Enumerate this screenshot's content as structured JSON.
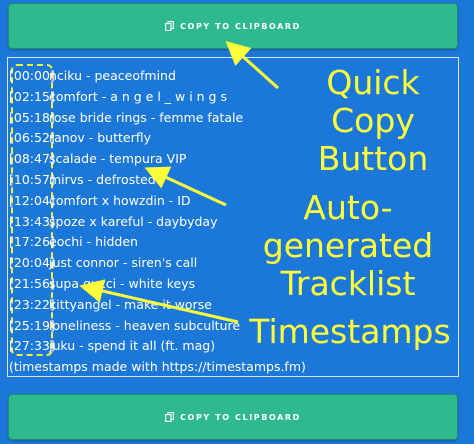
{
  "buttons": {
    "top_label": "COPY TO CLIPBOARD",
    "bottom_label": "COPY TO CLIPBOARD",
    "icon": "copy-icon"
  },
  "tracks": [
    {
      "time": "[00:00]",
      "title": "nciku - peaceofmind"
    },
    {
      "time": "[02:15]",
      "title": "comfort - a n g e l _ w i n g s"
    },
    {
      "time": "[05:18]",
      "title": "rose bride rings - femme fatale"
    },
    {
      "time": "[06:52]",
      "title": "ranov - butterfly"
    },
    {
      "time": "[08:47]",
      "title": "scalade - tempura VIP"
    },
    {
      "time": "[10:57]",
      "title": "mirvs - defrosted"
    },
    {
      "time": "[12:04]",
      "title": "comfort x howzdin - ID"
    },
    {
      "time": "[13:43]",
      "title": "spoze x kareful - daybyday"
    },
    {
      "time": "[17:26]",
      "title": "eochi - hidden"
    },
    {
      "time": "[20:04]",
      "title": "just connor - siren's call"
    },
    {
      "time": "[21:56]",
      "title": "supa gucci - white keys"
    },
    {
      "time": "[23:22]",
      "title": "kittyangel - make it worse"
    },
    {
      "time": "[25:19]",
      "title": "loneliness - heaven subculture"
    },
    {
      "time": "[27:33]",
      "title": "juku - spend it all (ft. mag)"
    }
  ],
  "footer_note": "(timestamps made with https://timestamps.fm)",
  "annotations": {
    "quick_copy_line1": "Quick Copy",
    "quick_copy_line2": "Button",
    "tracklist_line1": "Auto-generated",
    "tracklist_line2": "Tracklist",
    "timestamps": "Timestamps"
  },
  "colors": {
    "background": "#1c78d8",
    "button": "#2fb98f",
    "annotation": "#ffff3a",
    "text": "#ffffff"
  }
}
